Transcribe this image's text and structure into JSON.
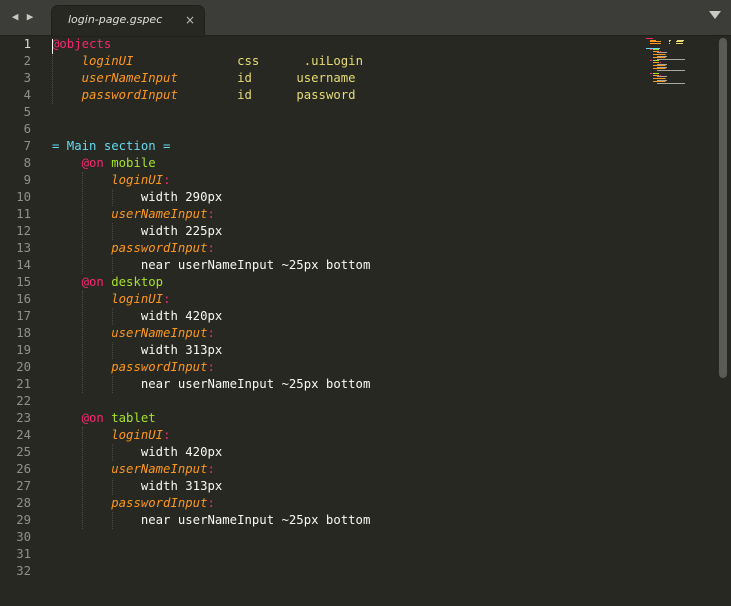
{
  "tabs": [
    {
      "label": "login-page.gspec",
      "active": true
    }
  ],
  "colors": {
    "background": "#272822",
    "at_keyword": "#f92672",
    "object_name": "#fd971f",
    "string": "#e6db74",
    "section": "#66d9ef",
    "device": "#a6e22e",
    "plain": "#f8f8f2",
    "line_number": "#8f908a"
  },
  "icons": {
    "nav_left": "◀",
    "nav_right": "▶",
    "close": "×",
    "menu": "chevron-down-icon"
  },
  "editor": {
    "active_line": 1,
    "lines": [
      {
        "n": "1",
        "tokens": [
          [
            "at",
            "@objects"
          ]
        ]
      },
      {
        "n": "2",
        "tokens": [
          [
            "plain",
            "    "
          ],
          [
            "name",
            "loginUI"
          ],
          [
            "plain",
            "              "
          ],
          [
            "kw",
            "css"
          ],
          [
            "plain",
            "      "
          ],
          [
            "kw",
            ".uiLogin"
          ]
        ]
      },
      {
        "n": "3",
        "tokens": [
          [
            "plain",
            "    "
          ],
          [
            "name",
            "userNameInput"
          ],
          [
            "plain",
            "        "
          ],
          [
            "kw",
            "id"
          ],
          [
            "plain",
            "      "
          ],
          [
            "kw",
            "username"
          ]
        ]
      },
      {
        "n": "4",
        "tokens": [
          [
            "plain",
            "    "
          ],
          [
            "name",
            "passwordInput"
          ],
          [
            "plain",
            "        "
          ],
          [
            "kw",
            "id"
          ],
          [
            "plain",
            "      "
          ],
          [
            "kw",
            "password"
          ]
        ]
      },
      {
        "n": "5",
        "tokens": []
      },
      {
        "n": "6",
        "tokens": []
      },
      {
        "n": "7",
        "tokens": [
          [
            "sec",
            "= Main section ="
          ]
        ]
      },
      {
        "n": "8",
        "tokens": [
          [
            "plain",
            "    "
          ],
          [
            "at",
            "@on"
          ],
          [
            "plain",
            " "
          ],
          [
            "dev",
            "mobile"
          ]
        ]
      },
      {
        "n": "9",
        "tokens": [
          [
            "plain",
            "        "
          ],
          [
            "name",
            "loginUI"
          ],
          [
            "colon",
            ":"
          ]
        ]
      },
      {
        "n": "10",
        "tokens": [
          [
            "plain",
            "            width 290px"
          ]
        ]
      },
      {
        "n": "11",
        "tokens": [
          [
            "plain",
            "        "
          ],
          [
            "name",
            "userNameInput"
          ],
          [
            "colon",
            ":"
          ]
        ]
      },
      {
        "n": "12",
        "tokens": [
          [
            "plain",
            "            width 225px"
          ]
        ]
      },
      {
        "n": "13",
        "tokens": [
          [
            "plain",
            "        "
          ],
          [
            "name",
            "passwordInput"
          ],
          [
            "colon",
            ":"
          ]
        ]
      },
      {
        "n": "14",
        "tokens": [
          [
            "plain",
            "            near userNameInput ~25px bottom"
          ]
        ]
      },
      {
        "n": "15",
        "tokens": [
          [
            "plain",
            "    "
          ],
          [
            "at",
            "@on"
          ],
          [
            "plain",
            " "
          ],
          [
            "dev",
            "desktop"
          ]
        ]
      },
      {
        "n": "16",
        "tokens": [
          [
            "plain",
            "        "
          ],
          [
            "name",
            "loginUI"
          ],
          [
            "colon",
            ":"
          ]
        ]
      },
      {
        "n": "17",
        "tokens": [
          [
            "plain",
            "            width 420px"
          ]
        ]
      },
      {
        "n": "18",
        "tokens": [
          [
            "plain",
            "        "
          ],
          [
            "name",
            "userNameInput"
          ],
          [
            "colon",
            ":"
          ]
        ]
      },
      {
        "n": "19",
        "tokens": [
          [
            "plain",
            "            width 313px"
          ]
        ]
      },
      {
        "n": "20",
        "tokens": [
          [
            "plain",
            "        "
          ],
          [
            "name",
            "passwordInput"
          ],
          [
            "colon",
            ":"
          ]
        ]
      },
      {
        "n": "21",
        "tokens": [
          [
            "plain",
            "            near userNameInput ~25px bottom"
          ]
        ]
      },
      {
        "n": "22",
        "tokens": []
      },
      {
        "n": "23",
        "tokens": [
          [
            "plain",
            "    "
          ],
          [
            "at",
            "@on"
          ],
          [
            "plain",
            " "
          ],
          [
            "dev",
            "tablet"
          ]
        ]
      },
      {
        "n": "24",
        "tokens": [
          [
            "plain",
            "        "
          ],
          [
            "name",
            "loginUI"
          ],
          [
            "colon",
            ":"
          ]
        ]
      },
      {
        "n": "25",
        "tokens": [
          [
            "plain",
            "            width 420px"
          ]
        ]
      },
      {
        "n": "26",
        "tokens": [
          [
            "plain",
            "        "
          ],
          [
            "name",
            "userNameInput"
          ],
          [
            "colon",
            ":"
          ]
        ]
      },
      {
        "n": "27",
        "tokens": [
          [
            "plain",
            "            width 313px"
          ]
        ]
      },
      {
        "n": "28",
        "tokens": [
          [
            "plain",
            "        "
          ],
          [
            "name",
            "passwordInput"
          ],
          [
            "colon",
            ":"
          ]
        ]
      },
      {
        "n": "29",
        "tokens": [
          [
            "plain",
            "            near userNameInput ~25px bottom"
          ]
        ]
      },
      {
        "n": "30",
        "tokens": []
      },
      {
        "n": "31",
        "tokens": []
      },
      {
        "n": "32",
        "tokens": []
      }
    ]
  }
}
